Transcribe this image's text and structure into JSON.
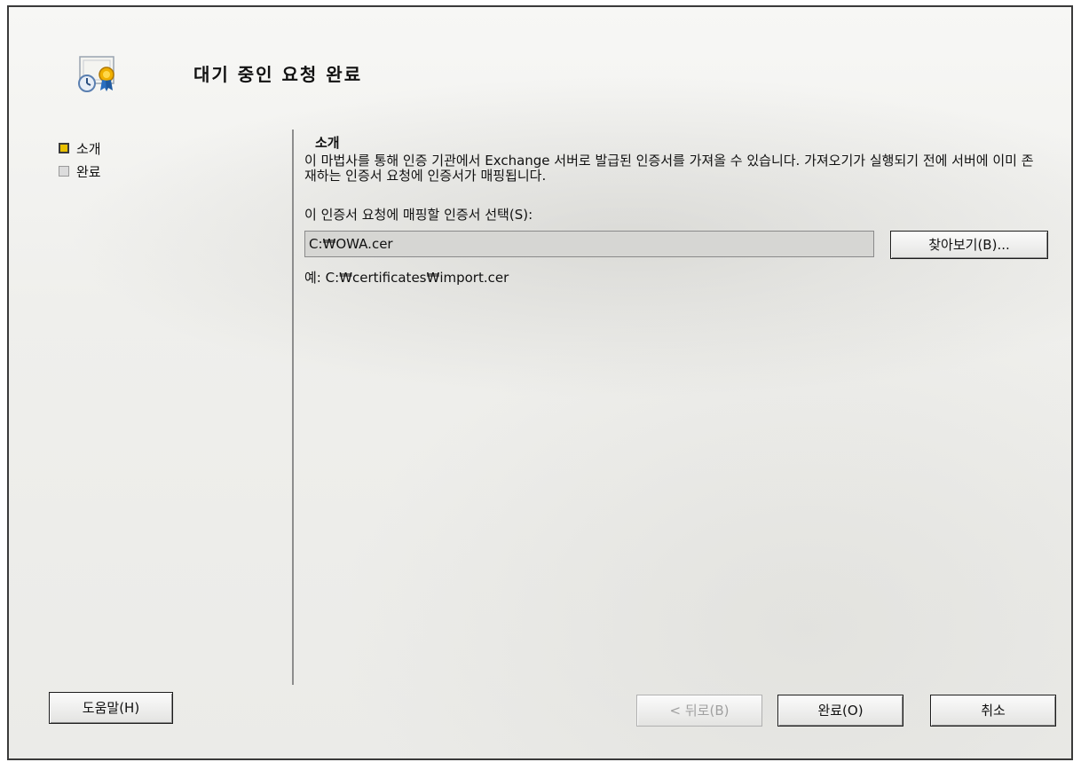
{
  "wizard": {
    "title": "대기 중인 요청 완료"
  },
  "steps": [
    {
      "label": "소개",
      "active": true
    },
    {
      "label": "완료",
      "active": false
    }
  ],
  "content": {
    "section_title": "소개",
    "description": "이 마법사를 통해 인증 기관에서 Exchange 서버로 발급된 인증서를 가져올 수 있습니다. 가져오기가 실행되기 전에 서버에 이미 존재하는 인증서 요청에 인증서가 매핑됩니다.",
    "select_label": "이 인증서 요청에 매핑할 인증서 선택(S):",
    "file_value": "C:₩OWA.cer",
    "browse_label": "찾아보기(B)...",
    "example": "예: C:₩certificates₩import.cer"
  },
  "buttons": {
    "help": "도움말(H)",
    "back": "< 뒤로(B)",
    "finish": "완료(O)",
    "cancel": "취소"
  },
  "colors": {
    "active_step": "#e8c000",
    "inactive_step": "#dcdcdc"
  },
  "icons": {
    "header": "certificate-icon"
  }
}
